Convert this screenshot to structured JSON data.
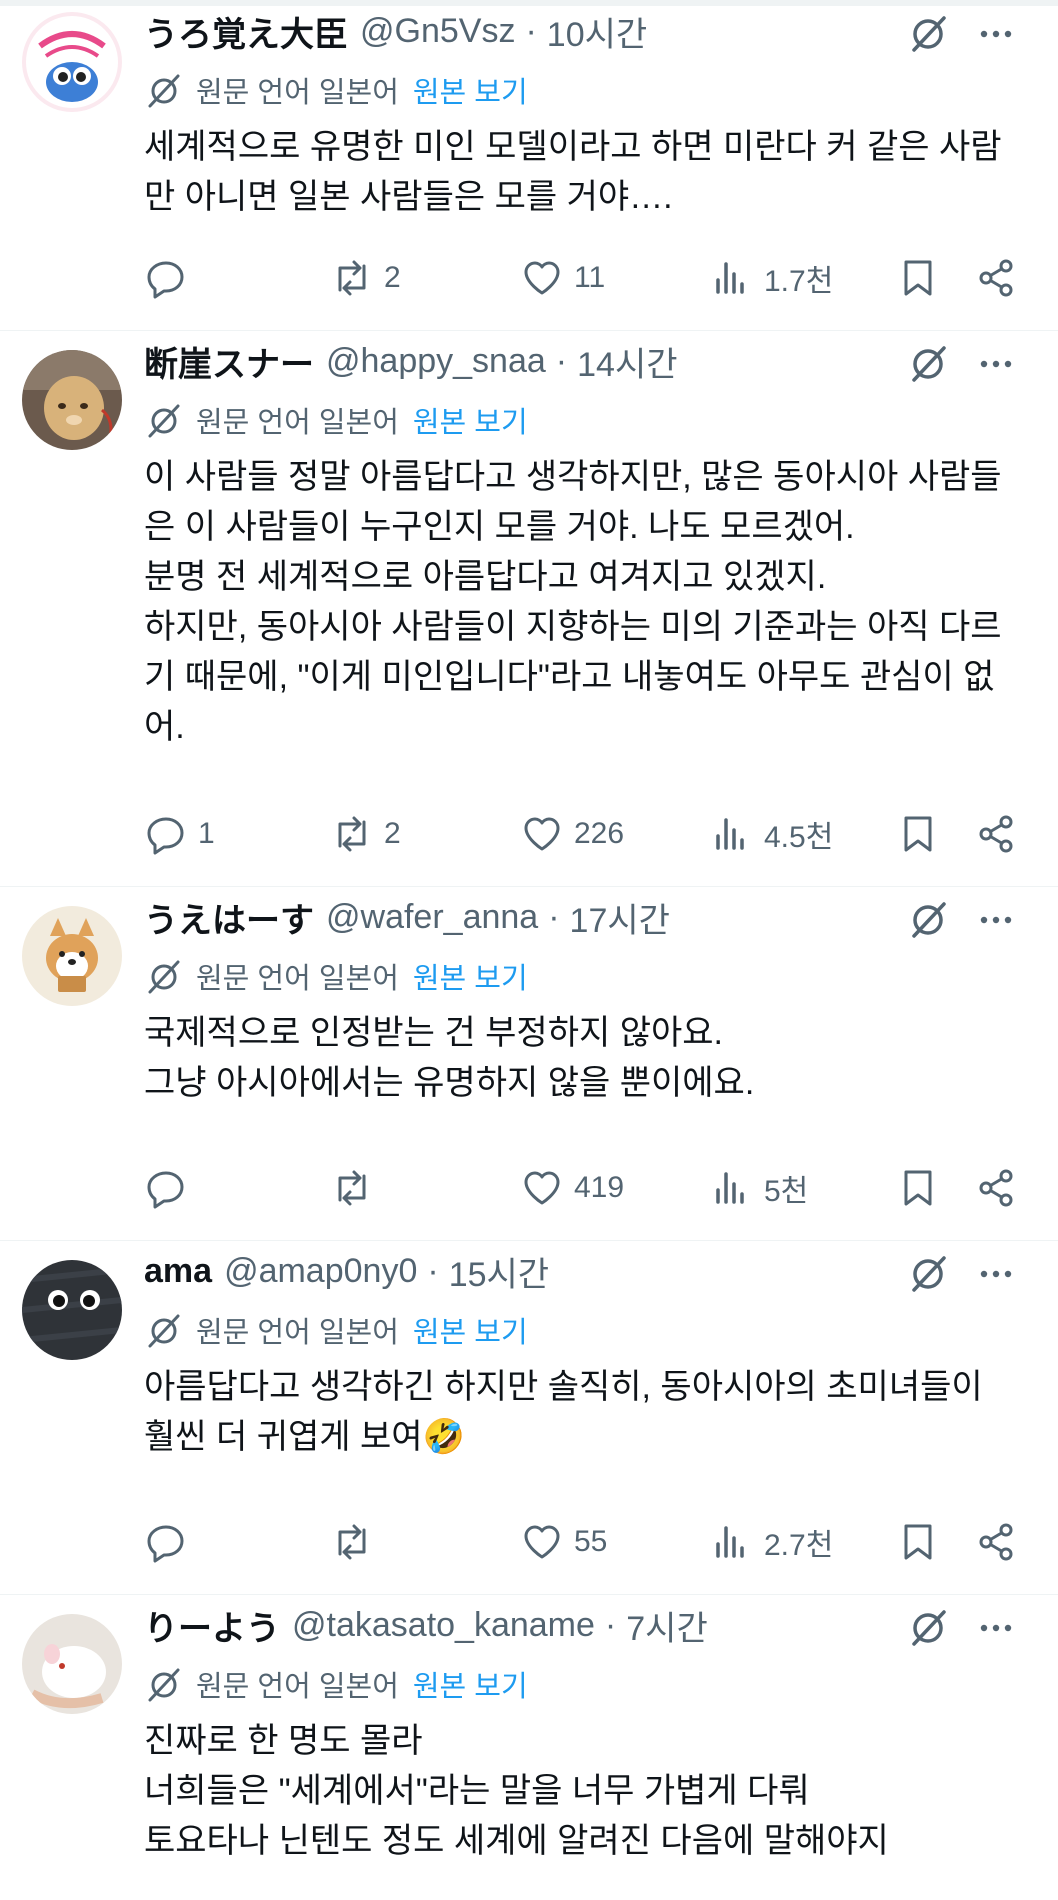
{
  "colors": {
    "text": "#0f1419",
    "secondary": "#536471",
    "link": "#1d9bf0",
    "divider": "#eff3f4"
  },
  "icons": {
    "grok": "grok-icon",
    "more": "more-icon",
    "translate": "translate-icon",
    "reply": "reply-icon",
    "retweet": "retweet-icon",
    "like": "like-icon",
    "views": "views-icon",
    "bookmark": "bookmark-icon",
    "share": "share-icon"
  },
  "tweets": [
    {
      "name": "うろ覚え大臣",
      "handle": "@Gn5Vsz",
      "time": "10시간",
      "translate_label": "원문 언어 일본어",
      "translate_link": "원본 보기",
      "text": "세계적으로 유명한 미인 모델이라고 하면 미란다 커 같은 사람\n만 아니면 일본 사람들은 모를 거야….",
      "replies": "",
      "retweets": "2",
      "likes": "11",
      "views": "1.7천"
    },
    {
      "name": "断崖スナー",
      "handle": "@happy_snaa",
      "time": "14시간",
      "translate_label": "원문 언어 일본어",
      "translate_link": "원본 보기",
      "text": "이 사람들 정말 아름답다고 생각하지만, 많은 동아시아 사람들\n은 이 사람들이 누구인지 모를 거야. 나도 모르겠어.\n분명 전 세계적으로 아름답다고 여겨지고 있겠지.\n하지만, 동아시아 사람들이 지향하는 미의 기준과는 아직 다르\n기 때문에, \"이게 미인입니다\"라고 내놓여도 아무도 관심이 없\n어.",
      "replies": "1",
      "retweets": "2",
      "likes": "226",
      "views": "4.5천"
    },
    {
      "name": "うえはーす",
      "handle": "@wafer_anna",
      "time": "17시간",
      "translate_label": "원문 언어 일본어",
      "translate_link": "원본 보기",
      "text": "국제적으로 인정받는 건 부정하지 않아요.\n그냥 아시아에서는 유명하지 않을 뿐이에요.",
      "replies": "",
      "retweets": "",
      "likes": "419",
      "views": "5천"
    },
    {
      "name": "ama",
      "handle": "@amap0ny0",
      "time": "15시간",
      "translate_label": "원문 언어 일본어",
      "translate_link": "원본 보기",
      "text": "아름답다고 생각하긴 하지만 솔직히, 동아시아의 초미녀들이\n훨씬 더 귀엽게 보여🤣",
      "replies": "",
      "retweets": "",
      "likes": "55",
      "views": "2.7천"
    },
    {
      "name": "りーよう",
      "handle": "@takasato_kaname",
      "time": "7시간",
      "translate_label": "원문 언어 일본어",
      "translate_link": "원본 보기",
      "text": "진짜로 한 명도 몰라\n너희들은 \"세계에서\"라는 말을 너무 가볍게 다뤄\n토요타나 닌텐도 정도 세계에 알려진 다음에 말해야지"
    }
  ]
}
